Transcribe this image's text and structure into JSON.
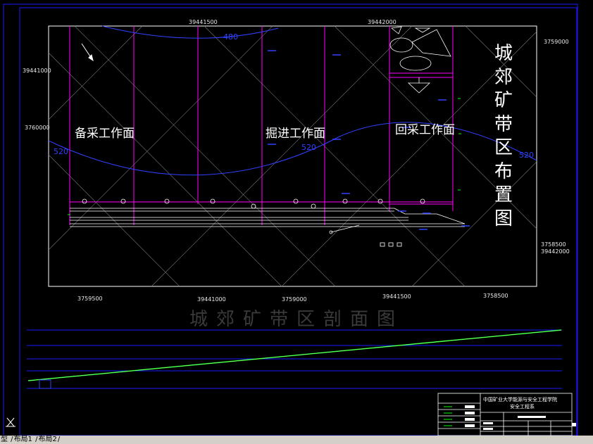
{
  "drawing": {
    "title": "城郊矿带区布置图",
    "section_title": "城郊矿带区剖面图",
    "zones": {
      "standby": "备采工作面",
      "driving": "掘进工作面",
      "mining": "回采工作面"
    },
    "contours": {
      "top": "480",
      "left": "520",
      "mid": "520",
      "right": "520"
    },
    "coords": {
      "top_a": "39441500",
      "top_b": "39442000",
      "left_a": "39441000",
      "left_b": "3760000",
      "right_a": "3759000",
      "right_b": "3758500",
      "right_c": "39442000",
      "bottom_a": "3759500",
      "bottom_b": "39441000",
      "bottom_c": "3759000",
      "bottom_d": "39441500",
      "bottom_e": "3758500"
    }
  },
  "title_block": {
    "school": "中国矿业大学能源与安全工程学院",
    "dept": "安全工程系"
  },
  "layout_tabs": [
    "型",
    "布局1",
    "布局2"
  ],
  "colors": {
    "frame": "#1a1aff",
    "magenta": "#ff00ff",
    "green": "#00ff00",
    "blue": "#3040ff"
  }
}
